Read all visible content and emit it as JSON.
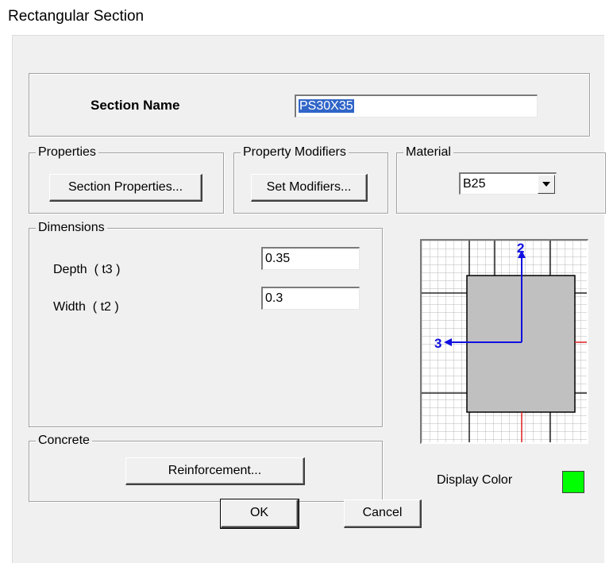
{
  "window": {
    "title": "Rectangular Section"
  },
  "section_name": {
    "label": "Section Name",
    "value": "PS30X35"
  },
  "properties": {
    "legend": "Properties",
    "button": "Section Properties..."
  },
  "property_modifiers": {
    "legend": "Property Modifiers",
    "button": "Set Modifiers..."
  },
  "material": {
    "legend": "Material",
    "selected": "B25"
  },
  "dimensions": {
    "legend": "Dimensions",
    "depth_label": "Depth  ( t3 )",
    "depth_value": "0.35",
    "width_label": "Width  ( t2 )",
    "width_value": "0.3"
  },
  "preview": {
    "axis_2_label": "2",
    "axis_3_label": "3"
  },
  "concrete": {
    "legend": "Concrete",
    "button": "Reinforcement..."
  },
  "display_color": {
    "label": "Display Color",
    "color": "#00ff00"
  },
  "footer": {
    "ok": "OK",
    "cancel": "Cancel"
  }
}
